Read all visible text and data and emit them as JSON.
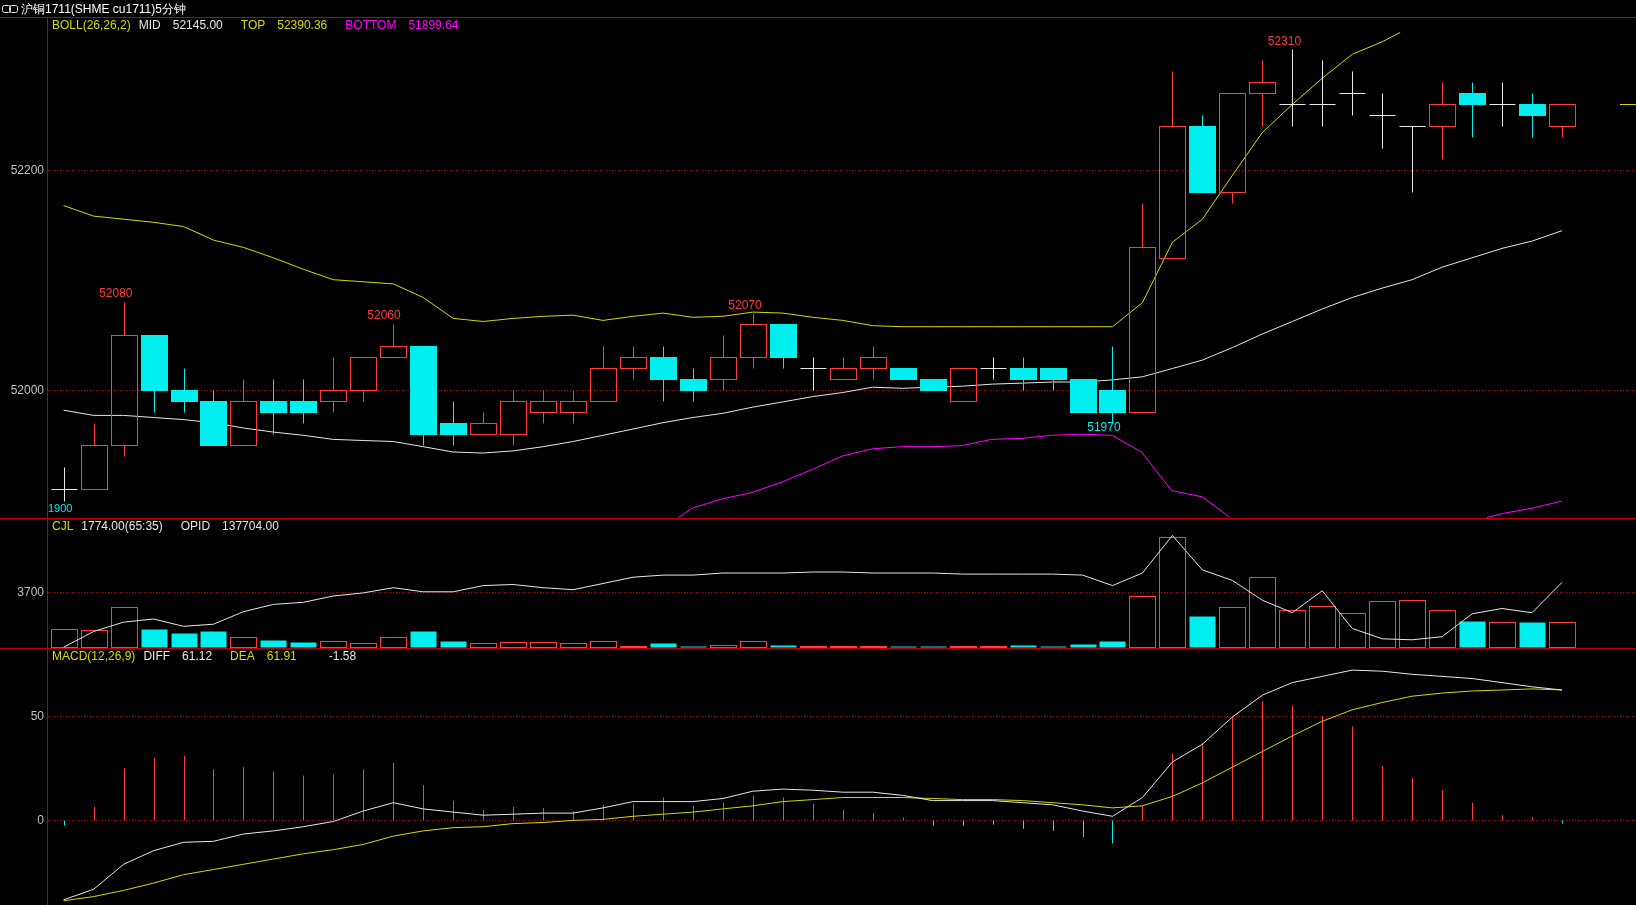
{
  "window": {
    "title": "沪铜1711(SHME cu1711)5分钟"
  },
  "panels": [
    {
      "kind": "price",
      "indicator": "BOLL(26,26,2)",
      "readouts": [
        {
          "kind": "mid",
          "label": "MID",
          "value": "52145.00"
        },
        {
          "kind": "upper",
          "label": "TOP",
          "value": "52390.36"
        },
        {
          "kind": "lower",
          "label": "BOTTOM",
          "value": "51899.64"
        }
      ],
      "axis_labels": [
        "52200",
        "52000"
      ],
      "price_tags": [
        {
          "kind": "high",
          "text": "52080"
        },
        {
          "kind": "high",
          "text": "52060"
        },
        {
          "kind": "high",
          "text": "52070"
        },
        {
          "kind": "high",
          "text": "52310"
        },
        {
          "kind": "low",
          "text": "51970"
        },
        {
          "kind": "low",
          "text": "1900"
        }
      ]
    },
    {
      "kind": "volume",
      "indicator": "CJL",
      "readouts": [
        {
          "kind": "volume",
          "value": "1774.00(65:35)"
        },
        {
          "kind": "volume",
          "label": "OPID",
          "value": "137704.00"
        }
      ],
      "axis_labels": [
        "3700"
      ]
    },
    {
      "kind": "macd",
      "indicator": "MACD(12,26,9)",
      "readouts": [
        {
          "kind": "diff",
          "label": "DIFF",
          "value": "61.12"
        },
        {
          "kind": "dea",
          "label": "DEA",
          "value": "61.91"
        },
        {
          "kind": "diff",
          "value": "-1.58"
        }
      ],
      "axis_labels": [
        "50",
        "0"
      ]
    }
  ]
}
